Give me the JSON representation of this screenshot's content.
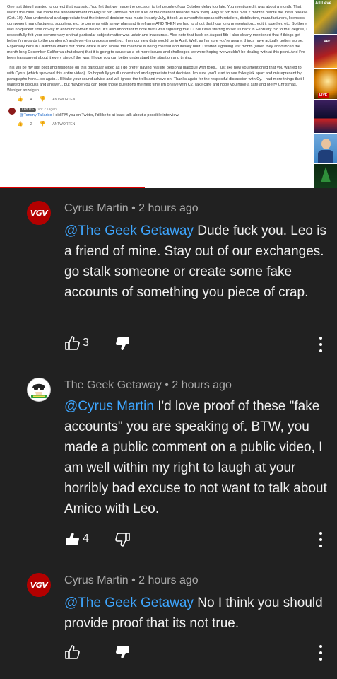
{
  "embedded_screenshot": {
    "paragraph_1": "One last thing I wanted to correct that you said.  You felt that we made the decision to tell people of our October delay too late.  You mentioned it was about a month.  That wasn't the case.  We made the announcement on August 5th (and we did list a lot of the different reasons back then).  August 5th was over 2 months before the initial release (Oct. 10).  Also understand and appreciate that the internal decision was made in early July, it took us a month to speak with retailers, distributors, manufacturers, licensors, component manufacturers, suppliers, etc. to come us with a new plan and timeframe AND THEN we had to shoot that hour long presentation... edit it together, etc.  So there was no quicker time or way to announce when we did.  It's also important to note that I was signaling that COVID was starting to set us back in February.  So to that degree, I respectfully felt your commentary on that particular subject matter was unfair and inaccurate.  Also note that back on August 5th I also clearly mentioned that if things get better (in regards to the pandemic) and everything goes smoothly... then our new date would be in April.  Well, as I'm sure you're aware, things have actually gotten worse.  Especially here in California where our home office is and where the machine is being created and initially built.  I started signaling last month (when they announced the month long December California shut down) that it is going to cause us a lot more issues and challenges we were hoping we wouldn't be dealing with at this point.  And I've been transparent about it every step of the way.  I hope you can better understand the situation and timing.",
    "paragraph_2": "This will be my last post and response on this particular video as I do prefer having real life personal dialogue with folks... just like how you mentioned that you wanted to with Cyrus (which spawned this entire video).  So hopefully you'll understand and appreciate that decision.  I'm sure you'll start to see folks pick apart and misrepresent by paragraphs here... so again... I'll take your sound advice and will ignore the trolls and move on.  Thanks again for the respectful discussion with Cy.  I had more things that I wanted to discuss and answer... but maybe you can pose those questions the next time I'm on live with Cy.  Take care and hope you have a safe and Merry Christmas.",
    "show_less": "Weniger anzeigen",
    "likes_1": "4",
    "reply_label_1": "ANTWORTEN",
    "reply_author": "Leo DS",
    "reply_time": "vor 2 Tagen",
    "reply_mention": "@Tommy Tallarico",
    "reply_text": " I did PM you on Twitter, I'd like to at least talk about a possible interview.",
    "likes_2": "2",
    "reply_label_2": "ANTWORTEN",
    "side_badge_1": "All Leve",
    "side_badge_2": "Ver",
    "side_badge_3": "LIVE"
  },
  "comments": [
    {
      "author": "Cyrus Martin",
      "time": " • 2 hours ago",
      "avatar_text": "VGV",
      "mention": "@The Geek Getaway",
      "text": " Dude fuck you. Leo is a friend of mine. Stay out of our exchanges. go stalk someone or create some fake accounts of something you piece of crap.",
      "likes": "3"
    },
    {
      "author": "The Geek Getaway",
      "time": " • 2 hours ago",
      "mention": "@Cyrus Martin",
      "text": " I'd love proof of these \"fake accounts\"  you are speaking of. BTW, you made a public comment on a public video, I am well within my right to laugh at your horribly bad excuse to not want to talk about Amico with Leo.",
      "likes": "4"
    },
    {
      "author": "Cyrus Martin",
      "time": " • 2 hours ago",
      "avatar_text": "VGV",
      "mention": "@The Geek Getaway",
      "text": " No I think you should provide proof that its not true.",
      "likes": ""
    }
  ],
  "icons": [
    "like-icon",
    "dislike-icon",
    "more-options-icon"
  ],
  "colors": {
    "background": "#212121",
    "mention": "#3ea6ff",
    "meta": "#aaaaaa",
    "vgv_red": "#b30000"
  }
}
